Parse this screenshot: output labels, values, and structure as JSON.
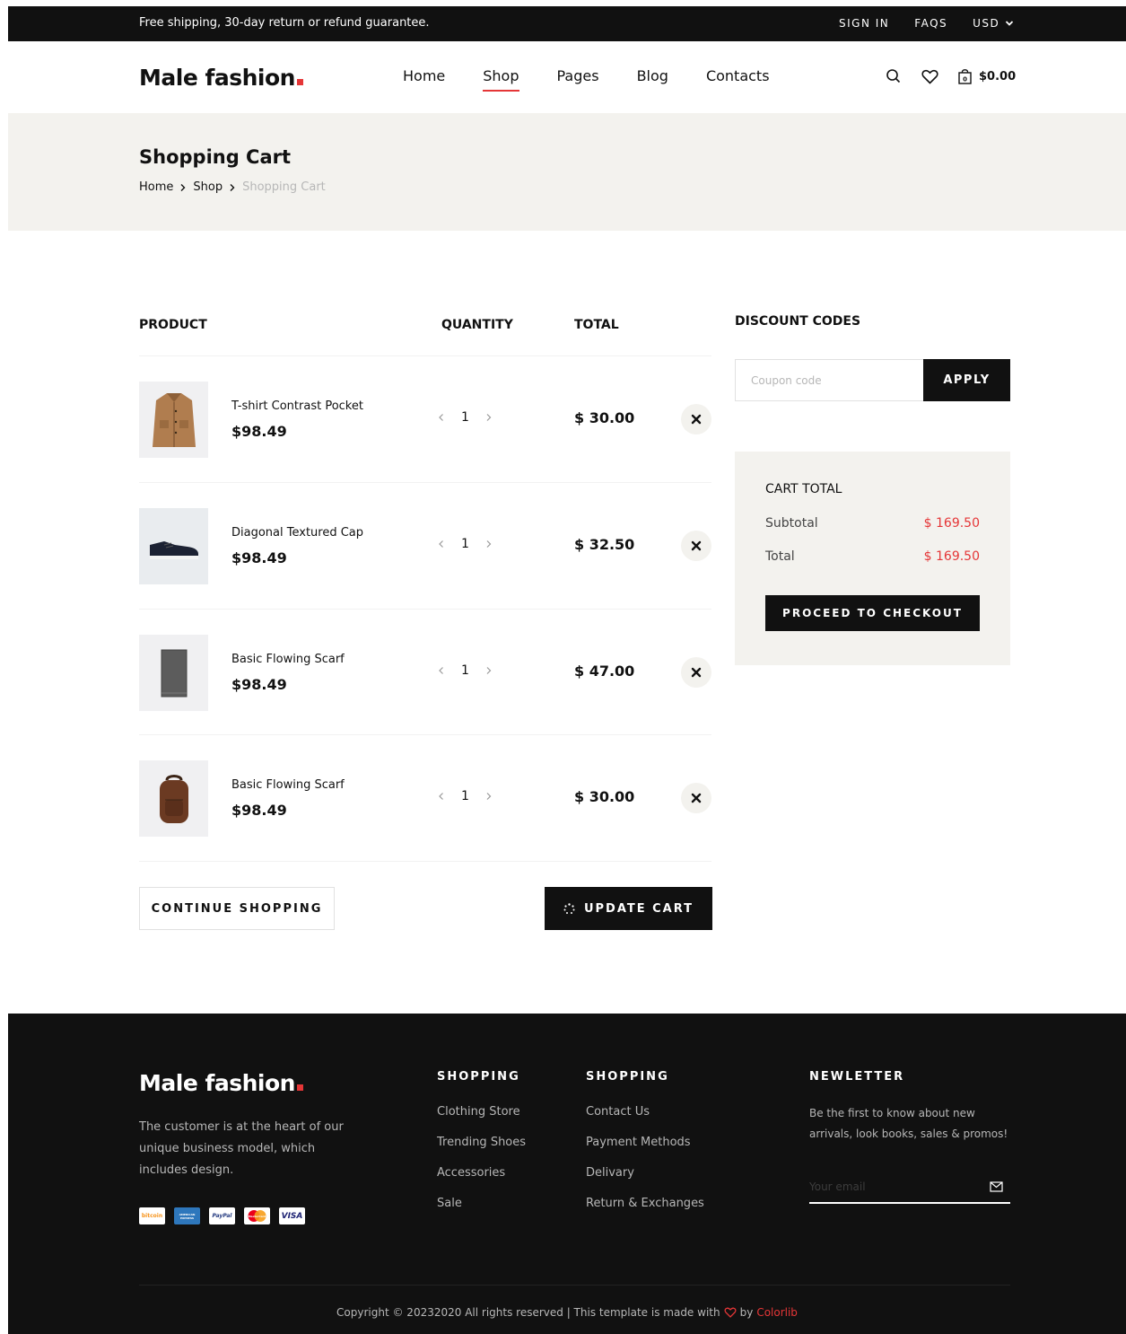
{
  "topbar": {
    "message": "Free shipping, 30-day return or refund guarantee.",
    "sign_in": "SIGN IN",
    "faqs": "FAQS",
    "currency": "USD"
  },
  "header": {
    "logo": "Male fashion",
    "nav": [
      {
        "label": "Home",
        "active": false
      },
      {
        "label": "Shop",
        "active": true
      },
      {
        "label": "Pages",
        "active": false
      },
      {
        "label": "Blog",
        "active": false
      },
      {
        "label": "Contacts",
        "active": false
      }
    ],
    "cart_amount": "$0.00"
  },
  "breadcrumb": {
    "title": "Shopping Cart",
    "items": [
      "Home",
      "Shop",
      "Shopping Cart"
    ]
  },
  "cart": {
    "headers": {
      "product": "PRODUCT",
      "quantity": "QUANTITY",
      "total": "TOTAL"
    },
    "items": [
      {
        "name": "T-shirt Contrast Pocket",
        "price": "$98.49",
        "qty": "1",
        "total": "$ 30.00",
        "image": "jacket"
      },
      {
        "name": "Diagonal Textured Cap",
        "price": "$98.49",
        "qty": "1",
        "total": "$ 32.50",
        "image": "sneaker"
      },
      {
        "name": "Basic Flowing Scarf",
        "price": "$98.49",
        "qty": "1",
        "total": "$ 47.00",
        "image": "scarf"
      },
      {
        "name": "Basic Flowing Scarf",
        "price": "$98.49",
        "qty": "1",
        "total": "$ 30.00",
        "image": "backpack"
      }
    ],
    "continue_label": "CONTINUE SHOPPING",
    "update_label": "UPDATE CART"
  },
  "discount": {
    "title": "DISCOUNT CODES",
    "placeholder": "Coupon code",
    "apply_label": "APPLY"
  },
  "cart_total": {
    "title": "CART TOTAL",
    "subtotal_label": "Subtotal",
    "subtotal_value": "$ 169.50",
    "total_label": "Total",
    "total_value": "$ 169.50",
    "checkout_label": "PROCEED TO CHECKOUT"
  },
  "footer": {
    "logo": "Male fashion",
    "about": "The customer is at the heart of our unique business model, which includes design.",
    "payments": [
      "bitcoin",
      "AMERICAN EXPRESS",
      "PayPal",
      "MasterCard",
      "VISA"
    ],
    "col1": {
      "title": "SHOPPING",
      "links": [
        "Clothing Store",
        "Trending Shoes",
        "Accessories",
        "Sale"
      ]
    },
    "col2": {
      "title": "SHOPPING",
      "links": [
        "Contact Us",
        "Payment Methods",
        "Delivary",
        "Return & Exchanges"
      ]
    },
    "newsletter": {
      "title": "NEWLETTER",
      "text": "Be the first to know about new arrivals, look books, sales & promos!",
      "placeholder": "Your email"
    },
    "copyright_prefix": "Copyright © 20232020 All rights reserved | This template is made with",
    "copyright_by": "by",
    "copyright_brand": "Colorlib"
  },
  "colors": {
    "accent": "#e53637",
    "dark": "#111111",
    "band": "#f3f2ee"
  }
}
